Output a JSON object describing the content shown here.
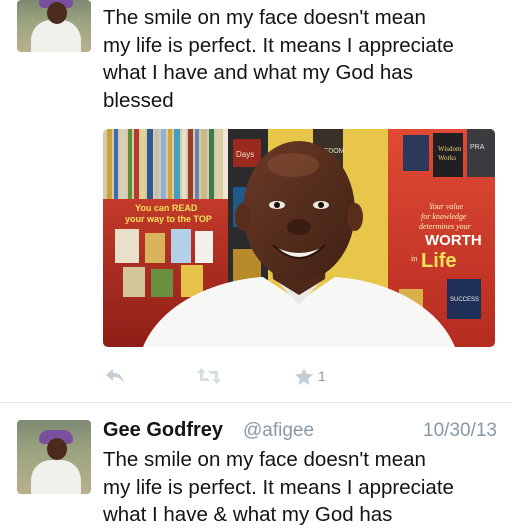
{
  "tweets": [
    {
      "text": "The smile on my face doesn't mean\nmy life is perfect. It means I appreciate\nwhat I have and what my God has\nblessed",
      "media": {
        "poster_left": "You can READ your way to the TOP",
        "poster_right": "Your value for knowledge determines your WORTH in Life",
        "book_titles": [
          "Days",
          "WISDOM",
          "Wisdom Works",
          "PRA",
          "SUCCESS"
        ]
      },
      "favorite_count": "1"
    },
    {
      "name": "Gee Godfrey",
      "handle": "@afigee",
      "date": "10/30/13",
      "text": "The smile on my face doesn't mean\nmy life is perfect. It means I appreciate\nwhat I have & what my God has"
    }
  ],
  "colors": {
    "meta_gray": "#8899a6",
    "icon_gray": "#c5ced6",
    "divider": "#e1e8ed"
  },
  "icons": [
    "reply-icon",
    "retweet-icon",
    "favorite-icon"
  ]
}
